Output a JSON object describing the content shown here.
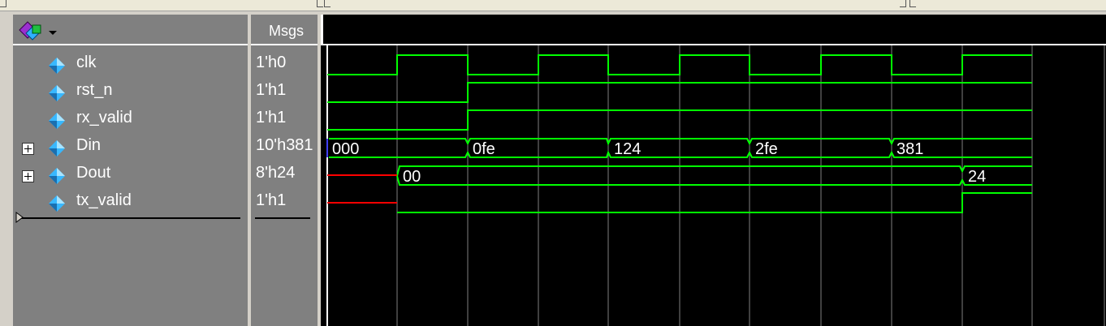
{
  "header": {
    "msgs_label": "Msgs"
  },
  "signals": [
    {
      "name": "clk",
      "value": "1'h0",
      "expandable": false
    },
    {
      "name": "rst_n",
      "value": "1'h1",
      "expandable": false
    },
    {
      "name": "rx_valid",
      "value": "1'h1",
      "expandable": false
    },
    {
      "name": "Din",
      "value": "10'h381",
      "expandable": true
    },
    {
      "name": "Dout",
      "value": "8'h24",
      "expandable": true
    },
    {
      "name": "tx_valid",
      "value": "1'h1",
      "expandable": false
    }
  ],
  "bus_labels": {
    "din": [
      "000",
      "0fe",
      "124",
      "2fe",
      "381"
    ],
    "dout": [
      "00",
      "24"
    ]
  },
  "colors": {
    "wave_green": "#00ff00",
    "undefined_red": "#ff0000",
    "grid": "#808080",
    "pane_gray": "#808080",
    "background": "#000000"
  },
  "icons": [
    "wave-tool-icon",
    "dropdown-arrow-icon",
    "signal-diamond-icon",
    "expand-plus-icon",
    "cursor-arrow-icon"
  ]
}
